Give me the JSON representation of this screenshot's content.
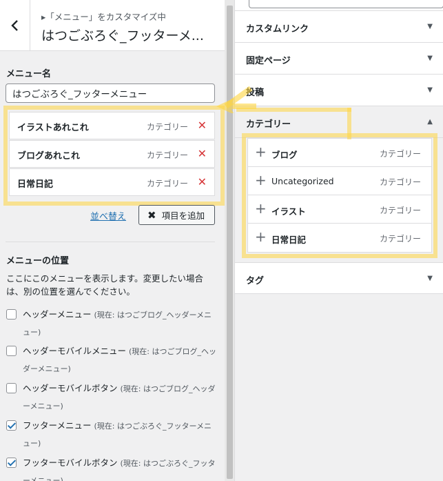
{
  "header": {
    "breadcrumb": "▸「メニュー」をカスタマイズ中",
    "title": "はつごぶろぐ_フッターメ..."
  },
  "menu_name": {
    "label": "メニュー名",
    "value": "はつごぶろぐ_フッターメニュー"
  },
  "menu_items": [
    {
      "title": "イラストあれこれ",
      "type": "カテゴリー",
      "remove": "✕"
    },
    {
      "title": "ブログあれこれ",
      "type": "カテゴリー",
      "remove": "✕"
    },
    {
      "title": "日常日記",
      "type": "カテゴリー",
      "remove": "✕"
    }
  ],
  "actions": {
    "reorder": "並べ替え",
    "add_item": "項目を追加",
    "add_icon": "✖"
  },
  "locations": {
    "label": "メニューの位置",
    "description": "ここにこのメニューを表示します。変更したい場合は、別の位置を選んでください。",
    "options": [
      {
        "name": "ヘッダーメニュー",
        "current": "(現在: はつごブログ_ヘッダーメニュー)",
        "checked": false
      },
      {
        "name": "ヘッダーモバイルメニュー",
        "current": "(現在: はつごブログ_ヘッダーメニュー)",
        "checked": false
      },
      {
        "name": "ヘッダーモバイルボタン",
        "current": "(現在: はつごブログ_ヘッダーメニュー)",
        "checked": false
      },
      {
        "name": "フッターメニュー",
        "current": "(現在: はつごぶろぐ_フッターメニュー)",
        "checked": true
      },
      {
        "name": "フッターモバイルボタン",
        "current": "(現在: はつごぶろぐ_フッターメニュー)",
        "checked": true
      }
    ]
  },
  "right_sections": [
    {
      "label": "カスタムリンク",
      "arrow": "▼"
    },
    {
      "label": "固定ページ",
      "arrow": "▼"
    },
    {
      "label": "投稿",
      "arrow": "▼"
    },
    {
      "label": "カテゴリー",
      "arrow": "▲"
    },
    {
      "label": "タグ",
      "arrow": "▼"
    }
  ],
  "categories": [
    {
      "name": "ブログ",
      "type": "カテゴリー",
      "plus": "+"
    },
    {
      "name": "Uncategorized",
      "type": "カテゴリー",
      "plus": "+"
    },
    {
      "name": "イラスト",
      "type": "カテゴリー",
      "plus": "+"
    },
    {
      "name": "日常日記",
      "type": "カテゴリー",
      "plus": "+"
    }
  ],
  "colors": {
    "highlight": "#ffd640",
    "remove": "#d63638",
    "link": "#2271b1"
  }
}
